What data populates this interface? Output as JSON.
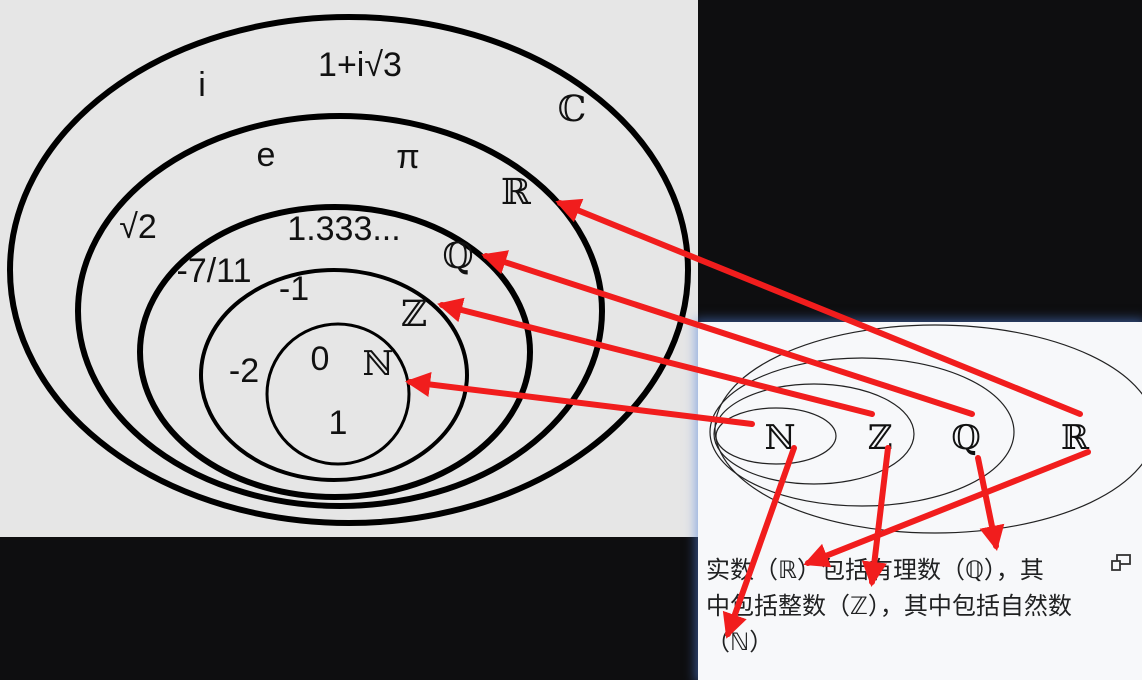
{
  "left_figure": {
    "set_symbols": {
      "complex": "ℂ",
      "real": "ℝ",
      "rational": "ℚ",
      "integer": "ℤ",
      "natural": "ℕ"
    },
    "examples": {
      "complex": [
        "i",
        "1+i√3"
      ],
      "real": [
        "e",
        "π",
        "√2"
      ],
      "rational": [
        "1.333...",
        "-7/11"
      ],
      "integer": [
        "-1",
        "-2"
      ],
      "natural": [
        "0",
        "1"
      ]
    }
  },
  "thumbnail": {
    "labels": [
      "ℕ",
      "ℤ",
      "ℚ",
      "ℝ"
    ]
  },
  "caption": {
    "line1": "实数（ℝ）包括有理数（ℚ），其",
    "line2": "中包括整数（ℤ），其中包括自然数",
    "line3": "（ℕ）"
  },
  "icons": {
    "expand": "expand-icon"
  },
  "colors": {
    "arrow": "#f11d1d",
    "panel_bg": "#f7f8fa",
    "figure_bg": "#e6e6e6",
    "glow": "#5a82dc"
  }
}
